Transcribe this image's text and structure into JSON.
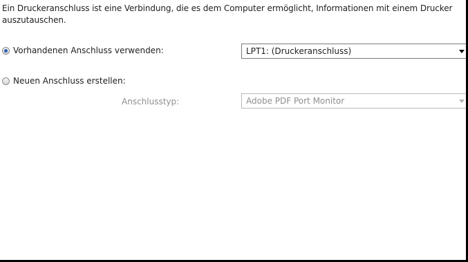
{
  "description": "Ein Druckeranschluss ist eine Verbindung, die es dem Computer ermöglicht, Informationen mit einem Drucker auszutauschen.",
  "options": {
    "existing": {
      "label": "Vorhandenen Anschluss verwenden:",
      "selected": true
    },
    "new": {
      "label": "Neuen Anschluss erstellen:",
      "selected": false
    }
  },
  "existing_port_select": {
    "value": "LPT1: (Druckeranschluss)"
  },
  "port_type": {
    "label": "Anschlusstyp:",
    "value": "Adobe PDF Port Monitor"
  }
}
